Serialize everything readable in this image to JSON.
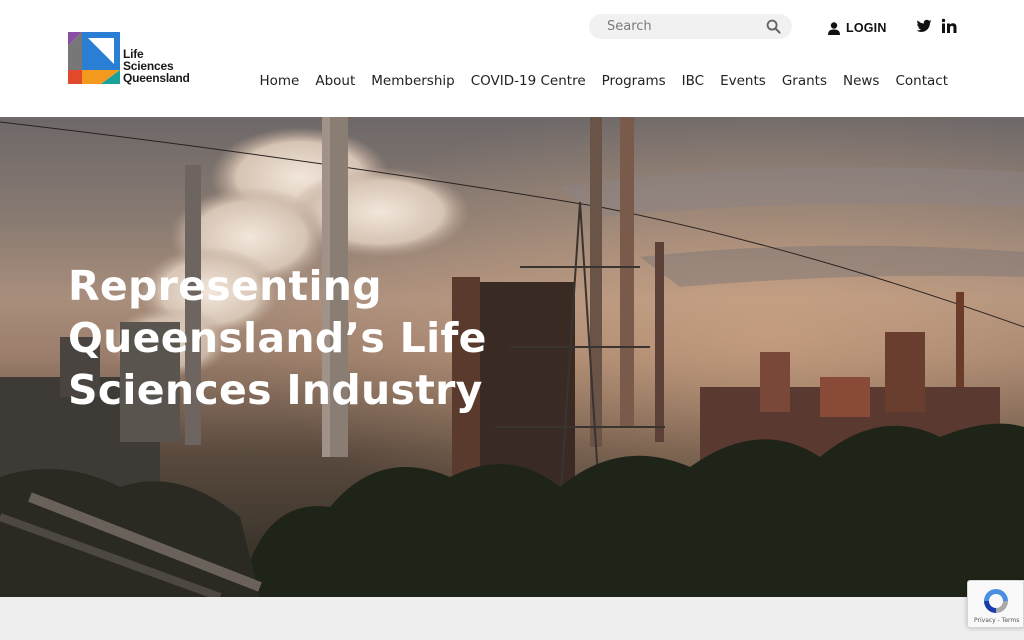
{
  "header": {
    "logo": {
      "line1": "Life",
      "line2": "Sciences",
      "line3": "Queensland"
    },
    "search": {
      "placeholder": "Search",
      "value": ""
    },
    "login_label": "LOGIN",
    "social": [
      "twitter-icon",
      "linkedin-icon"
    ]
  },
  "nav": {
    "items": [
      {
        "label": "Home"
      },
      {
        "label": "About"
      },
      {
        "label": "Membership"
      },
      {
        "label": "COVID-19 Centre"
      },
      {
        "label": "Programs"
      },
      {
        "label": "IBC"
      },
      {
        "label": "Events"
      },
      {
        "label": "Grants"
      },
      {
        "label": "News"
      },
      {
        "label": "Contact"
      }
    ]
  },
  "hero": {
    "title_line1": "Representing",
    "title_line2": "Queensland’s Life",
    "title_line3": "Sciences Industry"
  },
  "recaptcha": {
    "privacy": "Privacy",
    "terms": "Terms"
  },
  "colors": {
    "logo_purple": "#8a4fa3",
    "logo_blue": "#2a7fd4",
    "logo_orange": "#f39a1e",
    "logo_red": "#e0492c",
    "logo_teal": "#19a29a",
    "hero_text": "#ffffff"
  }
}
